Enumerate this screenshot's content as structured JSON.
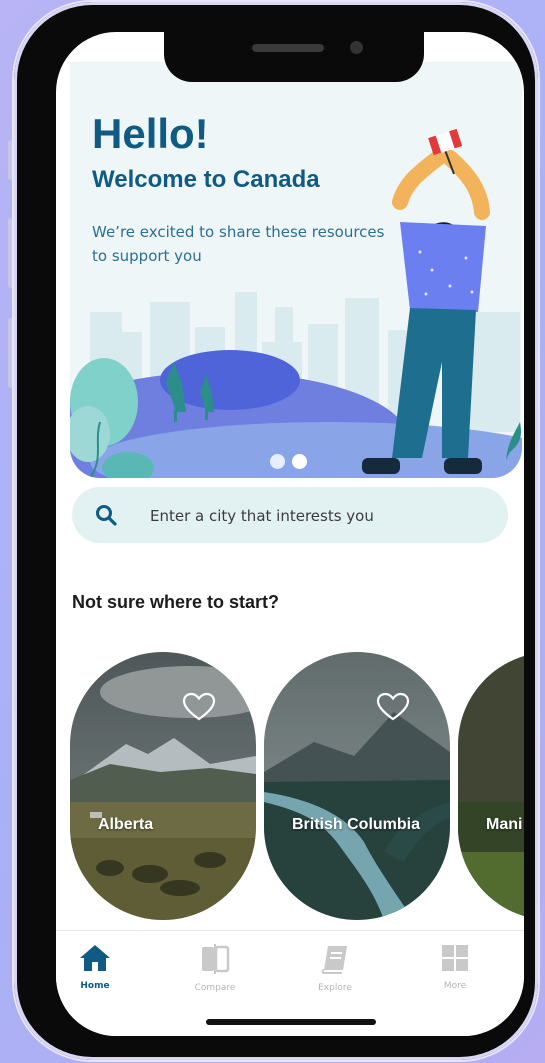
{
  "hero": {
    "title": "Hello!",
    "subtitle": "Welcome to Canada",
    "description": "We’re excited to share these resources to support you",
    "carousel": {
      "count": 2,
      "active_index": 1
    }
  },
  "search": {
    "placeholder": "Enter a city that interests you",
    "value": ""
  },
  "section": {
    "title": "Not sure where to start?"
  },
  "cards": [
    {
      "label": "Alberta",
      "favorite": false
    },
    {
      "label": "British Columbia",
      "favorite": false
    },
    {
      "label": "Mani"
    }
  ],
  "tabs": [
    {
      "label": "Home",
      "icon": "home-icon",
      "active": true
    },
    {
      "label": "Compare",
      "icon": "compare-icon",
      "active": false
    },
    {
      "label": "Explore",
      "icon": "explore-icon",
      "active": false
    },
    {
      "label": "More",
      "icon": "more-grid-icon",
      "active": false
    }
  ],
  "colors": {
    "brand_blue": "#0f5b84",
    "search_bg": "#e2f1f2",
    "tab_inactive": "#b5b5b5",
    "background": "#b8b4f5"
  }
}
